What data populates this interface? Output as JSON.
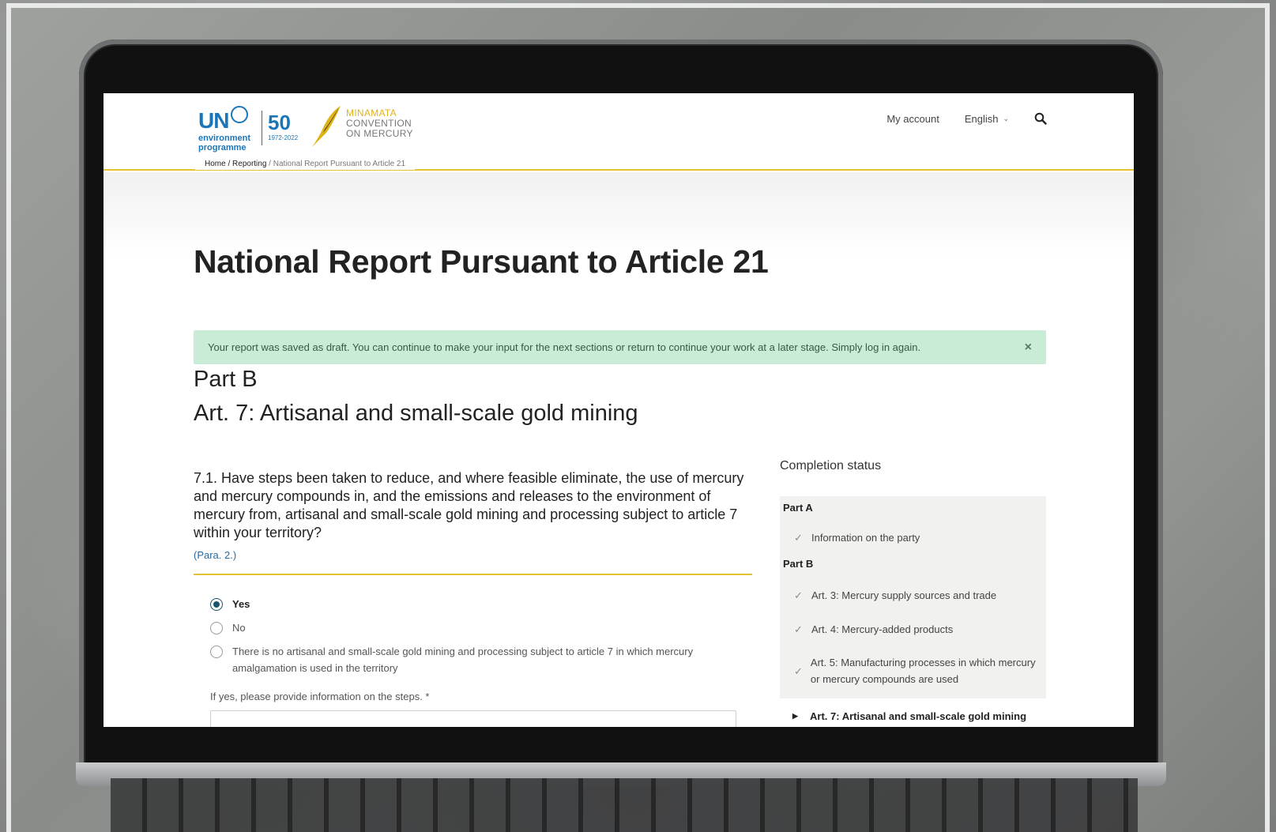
{
  "header": {
    "logo_un": "UN",
    "logo_env_line1": "environment",
    "logo_env_line2": "programme",
    "logo_fifty": "50",
    "logo_years": "1972-2022",
    "minamata_line1": "MINAMATA",
    "minamata_line2": "CONVENTION",
    "minamata_line3": "ON MERCURY",
    "my_account": "My account",
    "language": "English"
  },
  "breadcrumb": {
    "home": "Home",
    "reporting": "Reporting",
    "current": "National Report Pursuant to Article 21",
    "separator": " / "
  },
  "page": {
    "title": "National Report Pursuant to Article 21"
  },
  "alert": {
    "message": "Your report was saved as draft. You can continue to make your input for the next sections or return to continue your work at a later stage. Simply log in again.",
    "close": "×"
  },
  "section": {
    "part": "Part B",
    "title": "Art. 7: Artisanal and small-scale gold mining"
  },
  "question": {
    "text": "7.1. Have steps been taken to reduce, and where feasible eliminate, the use of mercury and mercury compounds in, and the emissions and releases to the environment of mercury from, artisanal and small-scale gold mining and processing subject to article 7 within your territory?",
    "reference": "(Para. 2.)",
    "options": [
      {
        "label": "Yes",
        "selected": true
      },
      {
        "label": "No",
        "selected": false
      },
      {
        "label": "There is no artisanal and small-scale gold mining and processing subject to article 7 in which mercury amalgamation is used in the territory",
        "selected": false
      }
    ],
    "steps_label": "If yes, please provide information on the steps. *"
  },
  "completion": {
    "heading": "Completion status",
    "part_a": "Part A",
    "part_a_items": [
      "Information on the party"
    ],
    "part_b": "Part B",
    "part_b_items": [
      "Art. 3: Mercury supply sources and trade",
      "Art. 4: Mercury-added products",
      "Art. 5: Manufacturing processes in which mercury or mercury compounds are used"
    ],
    "active_item": "Art. 7: Artisanal and small-scale gold mining"
  },
  "icons": {
    "search": "search-icon",
    "check": "check-icon",
    "chevron": "chevron-down-icon",
    "arrow": "arrow-right-icon"
  },
  "colors": {
    "accent_yellow": "#e6c233",
    "un_blue": "#1a76b8",
    "alert_green": "#c9ecd6",
    "radio_selected": "#17546f"
  }
}
